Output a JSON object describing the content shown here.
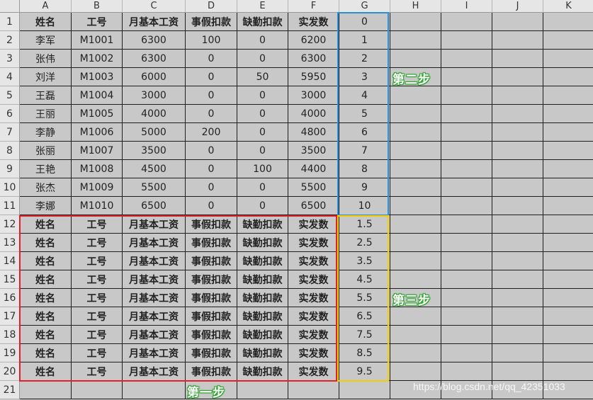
{
  "columns": [
    "A",
    "B",
    "C",
    "D",
    "E",
    "F",
    "G",
    "H",
    "I",
    "J",
    "K"
  ],
  "rows": [
    [
      "姓名",
      "工号",
      "月基本工资",
      "事假扣款",
      "缺勤扣款",
      "实发数",
      "0",
      "",
      "",
      "",
      ""
    ],
    [
      "李军",
      "M1001",
      "6300",
      "100",
      "0",
      "6200",
      "1",
      "",
      "",
      "",
      ""
    ],
    [
      "张伟",
      "M1002",
      "6300",
      "0",
      "0",
      "6300",
      "2",
      "",
      "",
      "",
      ""
    ],
    [
      "刘洋",
      "M1003",
      "6000",
      "0",
      "50",
      "5950",
      "3",
      "",
      "",
      "",
      ""
    ],
    [
      "王磊",
      "M1004",
      "3000",
      "0",
      "0",
      "3000",
      "4",
      "",
      "",
      "",
      ""
    ],
    [
      "王丽",
      "M1005",
      "4000",
      "0",
      "0",
      "4000",
      "5",
      "",
      "",
      "",
      ""
    ],
    [
      "李静",
      "M1006",
      "5000",
      "200",
      "0",
      "4800",
      "6",
      "",
      "",
      "",
      ""
    ],
    [
      "张丽",
      "M1007",
      "3500",
      "0",
      "0",
      "3500",
      "7",
      "",
      "",
      "",
      ""
    ],
    [
      "王艳",
      "M1008",
      "4500",
      "0",
      "100",
      "4400",
      "8",
      "",
      "",
      "",
      ""
    ],
    [
      "张杰",
      "M1009",
      "5500",
      "0",
      "0",
      "5500",
      "9",
      "",
      "",
      "",
      ""
    ],
    [
      "李娜",
      "M1010",
      "6500",
      "0",
      "0",
      "6500",
      "10",
      "",
      "",
      "",
      ""
    ],
    [
      "姓名",
      "工号",
      "月基本工资",
      "事假扣款",
      "缺勤扣款",
      "实发数",
      "1.5",
      "",
      "",
      "",
      ""
    ],
    [
      "姓名",
      "工号",
      "月基本工资",
      "事假扣款",
      "缺勤扣款",
      "实发数",
      "2.5",
      "",
      "",
      "",
      ""
    ],
    [
      "姓名",
      "工号",
      "月基本工资",
      "事假扣款",
      "缺勤扣款",
      "实发数",
      "3.5",
      "",
      "",
      "",
      ""
    ],
    [
      "姓名",
      "工号",
      "月基本工资",
      "事假扣款",
      "缺勤扣款",
      "实发数",
      "4.5",
      "",
      "",
      "",
      ""
    ],
    [
      "姓名",
      "工号",
      "月基本工资",
      "事假扣款",
      "缺勤扣款",
      "实发数",
      "5.5",
      "",
      "",
      "",
      ""
    ],
    [
      "姓名",
      "工号",
      "月基本工资",
      "事假扣款",
      "缺勤扣款",
      "实发数",
      "6.5",
      "",
      "",
      "",
      ""
    ],
    [
      "姓名",
      "工号",
      "月基本工资",
      "事假扣款",
      "缺勤扣款",
      "实发数",
      "7.5",
      "",
      "",
      "",
      ""
    ],
    [
      "姓名",
      "工号",
      "月基本工资",
      "事假扣款",
      "缺勤扣款",
      "实发数",
      "8.5",
      "",
      "",
      "",
      ""
    ],
    [
      "姓名",
      "工号",
      "月基本工资",
      "事假扣款",
      "缺勤扣款",
      "实发数",
      "9.5",
      "",
      "",
      "",
      ""
    ],
    [
      "",
      "",
      "",
      "",
      "",
      "",
      "",
      "",
      "",
      "",
      ""
    ]
  ],
  "bold_rows": [
    1,
    12,
    13,
    14,
    15,
    16,
    17,
    18,
    19,
    20
  ],
  "annotations": {
    "step1": "第一步",
    "step2": "第二步",
    "step3": "第三步"
  },
  "colors": {
    "red_box": "#e0202a",
    "blue_box": "#2a8fd6",
    "yellow_box": "#f0d000",
    "note_outline": "#2ea12e"
  },
  "watermark": "https://blog.csdn.net/qq_42351033"
}
